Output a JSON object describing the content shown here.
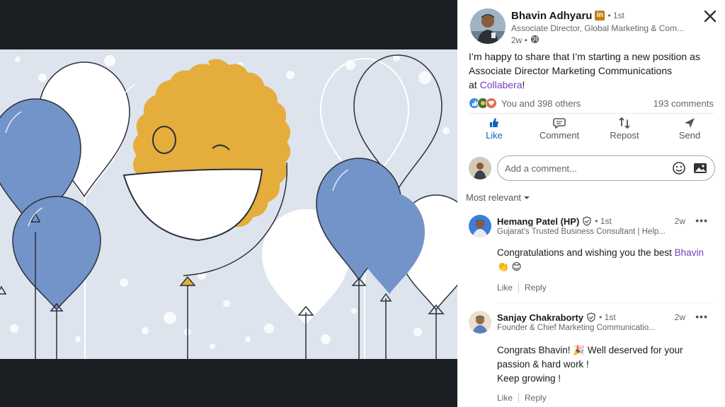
{
  "post": {
    "author": "Bhavin Adhyaru",
    "badge": "in",
    "degree": "• 1st",
    "title": "Associate Director, Global Marketing & Com...",
    "time": "2w •",
    "text_line1": "I’m happy to share that I’m starting a new position as",
    "text_line2": "Associate Director Marketing Communications",
    "text_at": "at ",
    "company": "Collabera",
    "text_end": "!"
  },
  "social": {
    "reactions_text": "You and 398 others",
    "comments_count": "193 comments"
  },
  "actions": {
    "like": "Like",
    "comment": "Comment",
    "repost": "Repost",
    "send": "Send"
  },
  "compose": {
    "placeholder": "Add a comment..."
  },
  "sort_label": "Most relevant",
  "comments": [
    {
      "name": "Hemang Patel (HP)",
      "degree": "• 1st",
      "title": "Gujarat's Trusted Business Consultant | Help...",
      "time": "2w",
      "text_before": "Congratulations and wishing you the best ",
      "mention": "Bhavin",
      "emojis": "👏 😊",
      "like": "Like",
      "reply": "Reply"
    },
    {
      "name": "Sanjay Chakraborty",
      "degree": "• 1st",
      "title": "Founder & Chief Marketing Communicatio...",
      "time": "2w",
      "line1": "Congrats Bhavin! 🎉 Well deserved for your",
      "line2": "passion & hard work !",
      "line3": "Keep growing !",
      "like": "Like",
      "reply": "Reply"
    }
  ],
  "icons": {
    "close": "close-icon",
    "globe": "globe-icon",
    "like": "thumbs-up-icon",
    "comment": "comment-bubble-icon",
    "repost": "repost-icon",
    "send": "send-icon",
    "emoji": "emoji-icon",
    "image": "image-icon",
    "verify": "verified-shield-icon",
    "more": "more-icon"
  },
  "colors": {
    "brand_blue": "#0a66c2",
    "mention_purple": "#7a3dc2",
    "balloon_blue": "#7294c8",
    "sun_yellow": "#e5ad3c",
    "art_bg": "#dde4ee"
  }
}
